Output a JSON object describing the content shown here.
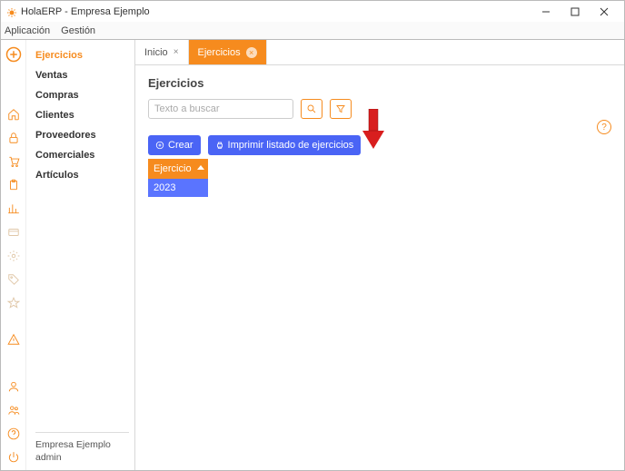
{
  "window": {
    "title": "HolaERP - Empresa Ejemplo"
  },
  "menubar": {
    "items": [
      "Aplicación",
      "Gestión"
    ]
  },
  "sidebar": {
    "items": [
      {
        "label": "Ejercicios",
        "active": true
      },
      {
        "label": "Ventas"
      },
      {
        "label": "Compras"
      },
      {
        "label": "Clientes"
      },
      {
        "label": "Proveedores"
      },
      {
        "label": "Comerciales"
      },
      {
        "label": "Artículos"
      }
    ],
    "footer": {
      "company": "Empresa Ejemplo",
      "user": "admin"
    }
  },
  "tabs": {
    "items": [
      {
        "label": "Inicio",
        "active": false
      },
      {
        "label": "Ejercicios",
        "active": true
      }
    ]
  },
  "page": {
    "title": "Ejercicios",
    "search_placeholder": "Texto a buscar",
    "btn_create": "Crear",
    "btn_print": "Imprimir listado de ejercicios",
    "grid_header": "Ejercicio",
    "grid_rows": [
      "2023"
    ],
    "help_label": "?"
  },
  "iconbar": {
    "top": [
      "plus-circle"
    ],
    "middle": [
      "home",
      "lock",
      "cart",
      "clipboard",
      "chart",
      "card",
      "settings",
      "tag",
      "star"
    ],
    "alert": [
      "warning"
    ],
    "bottom": [
      "user",
      "users",
      "help",
      "power"
    ]
  }
}
